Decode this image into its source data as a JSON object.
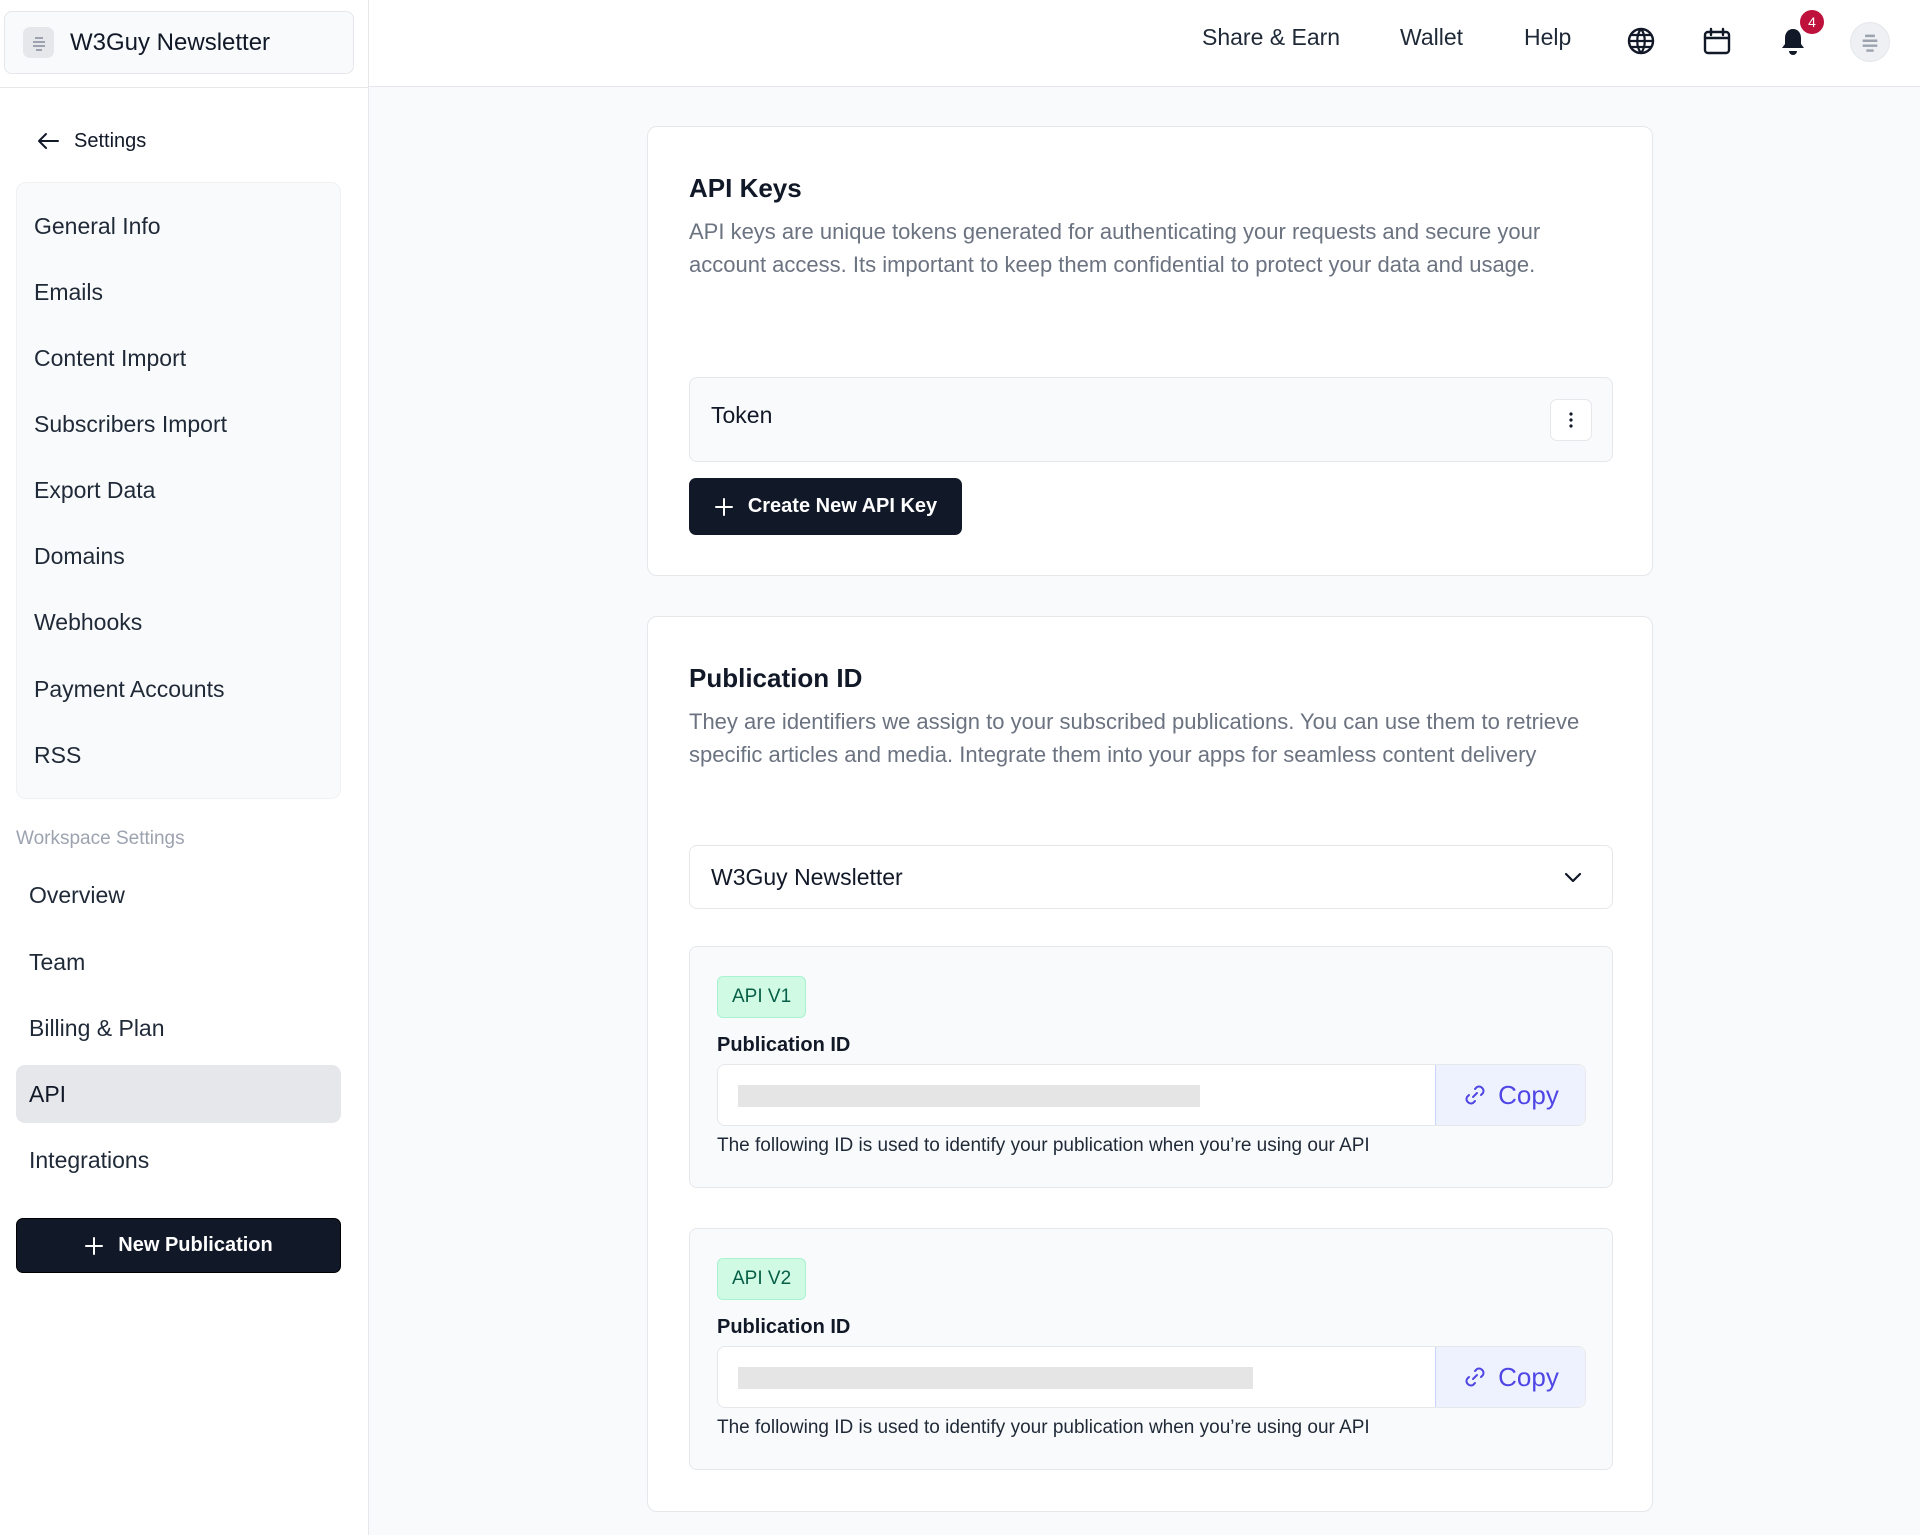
{
  "sidebar": {
    "publication_name": "W3Guy Newsletter",
    "back_label": "Settings",
    "settings_items": [
      {
        "label": "General Info"
      },
      {
        "label": "Emails"
      },
      {
        "label": "Content Import"
      },
      {
        "label": "Subscribers Import"
      },
      {
        "label": "Export Data"
      },
      {
        "label": "Domains"
      },
      {
        "label": "Webhooks"
      },
      {
        "label": "Payment Accounts"
      },
      {
        "label": "RSS"
      }
    ],
    "workspace_label": "Workspace Settings",
    "workspace_items": [
      {
        "label": "Overview",
        "active": false
      },
      {
        "label": "Team",
        "active": false
      },
      {
        "label": "Billing & Plan",
        "active": false
      },
      {
        "label": "API",
        "active": true
      },
      {
        "label": "Integrations",
        "active": false
      }
    ],
    "new_publication_label": "New Publication"
  },
  "topbar": {
    "nav": [
      "Share & Earn",
      "Wallet",
      "Help"
    ],
    "icons": [
      "globe-icon",
      "calendar-icon",
      "bell-icon"
    ],
    "notification_count": "4"
  },
  "api_keys": {
    "title": "API Keys",
    "description": "API keys are unique tokens generated for authenticating your requests and secure your account access. Its important to keep them confidential to protect your data and usage.",
    "token_label": "Token",
    "create_button": "Create New API Key"
  },
  "publication_id": {
    "title": "Publication ID",
    "description": "They are identifiers we assign to your subscribed publications. You can use them to retrieve specific articles and media. Integrate them into your apps for seamless content delivery",
    "selected_publication": "W3Guy Newsletter",
    "apis": [
      {
        "tag": "API V1",
        "field_label": "Publication ID",
        "copy_label": "Copy",
        "note": "The following ID is used to identify your publication when you’re using our API"
      },
      {
        "tag": "API V2",
        "field_label": "Publication ID",
        "copy_label": "Copy",
        "note": "The following ID is used to identify your publication when you’re using our API"
      }
    ]
  },
  "colors": {
    "primary_dark": "#111827",
    "accent": "#4f46e5",
    "tag_green_bg": "#d1fae5",
    "badge_red": "#be123c"
  }
}
